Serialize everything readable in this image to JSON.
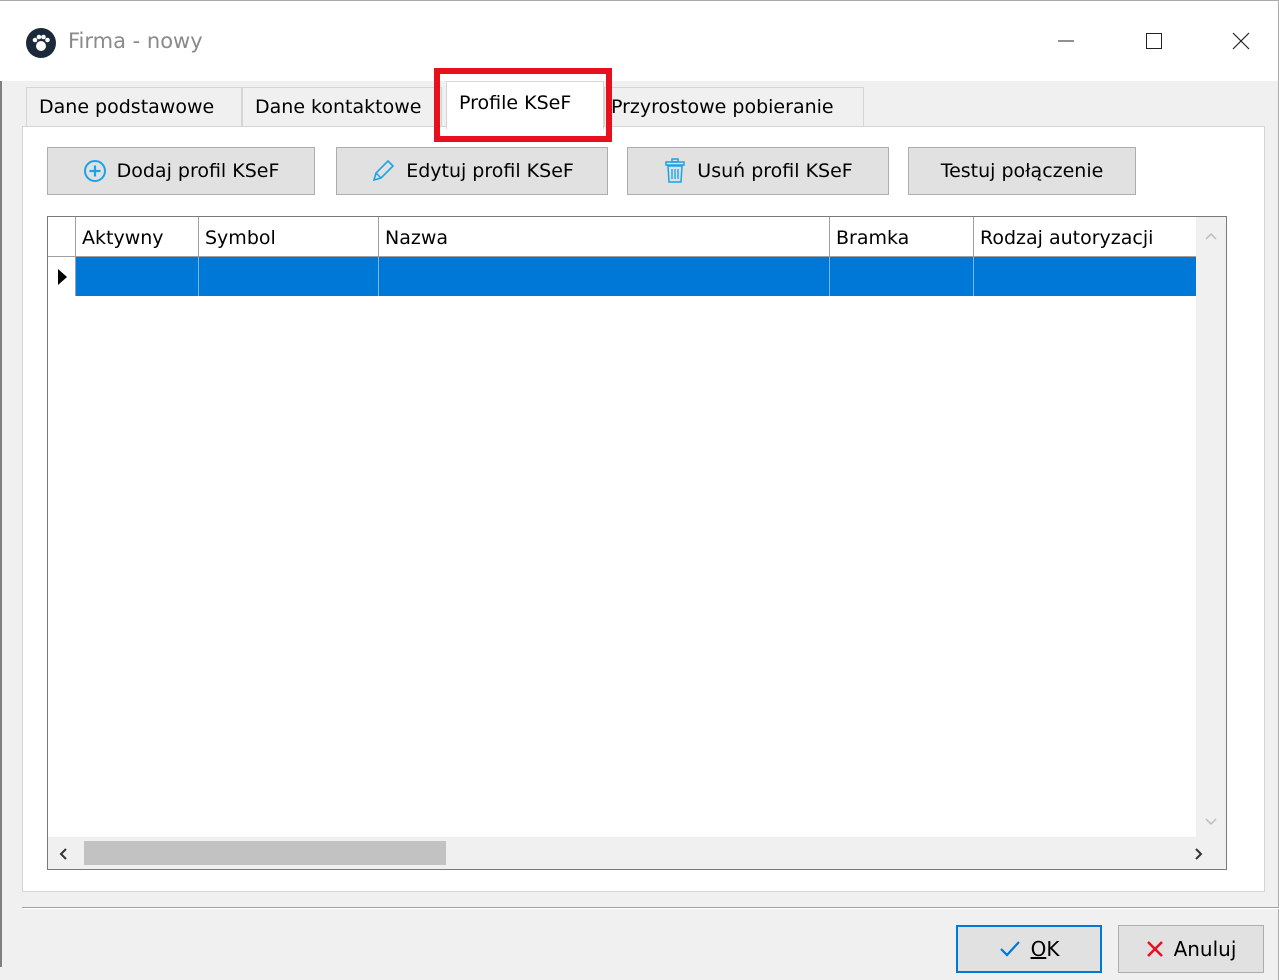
{
  "window": {
    "title": "Firma - nowy",
    "controls": {
      "minimize": "minimize-icon",
      "maximize": "maximize-icon",
      "close": "close-icon"
    }
  },
  "tabs": [
    {
      "label": "Dane podstawowe",
      "active": false
    },
    {
      "label": "Dane kontaktowe",
      "active": false
    },
    {
      "label": "Profile KSeF",
      "active": true
    },
    {
      "label": "Przyrostowe pobieranie",
      "active": false
    }
  ],
  "toolbar": {
    "add_label": "Dodaj profil KSeF",
    "edit_label": "Edytuj profil KSeF",
    "delete_label": "Usuń profil KSeF",
    "test_label": "Testuj połączenie"
  },
  "grid": {
    "columns": [
      "Aktywny",
      "Symbol",
      "Nazwa",
      "Bramka",
      "Rodzaj autoryzacji"
    ],
    "rows": [
      {
        "selected": true,
        "cells": [
          "",
          "",
          "",
          "",
          ""
        ]
      }
    ]
  },
  "footer": {
    "ok_label": "OK",
    "cancel_label": "Anuluj"
  },
  "colors": {
    "selection": "#0078d7",
    "highlight_box": "#e8101c",
    "add_icon": "#1aa3e6",
    "cancel_icon": "#e81123",
    "ok_icon": "#0078d7"
  }
}
